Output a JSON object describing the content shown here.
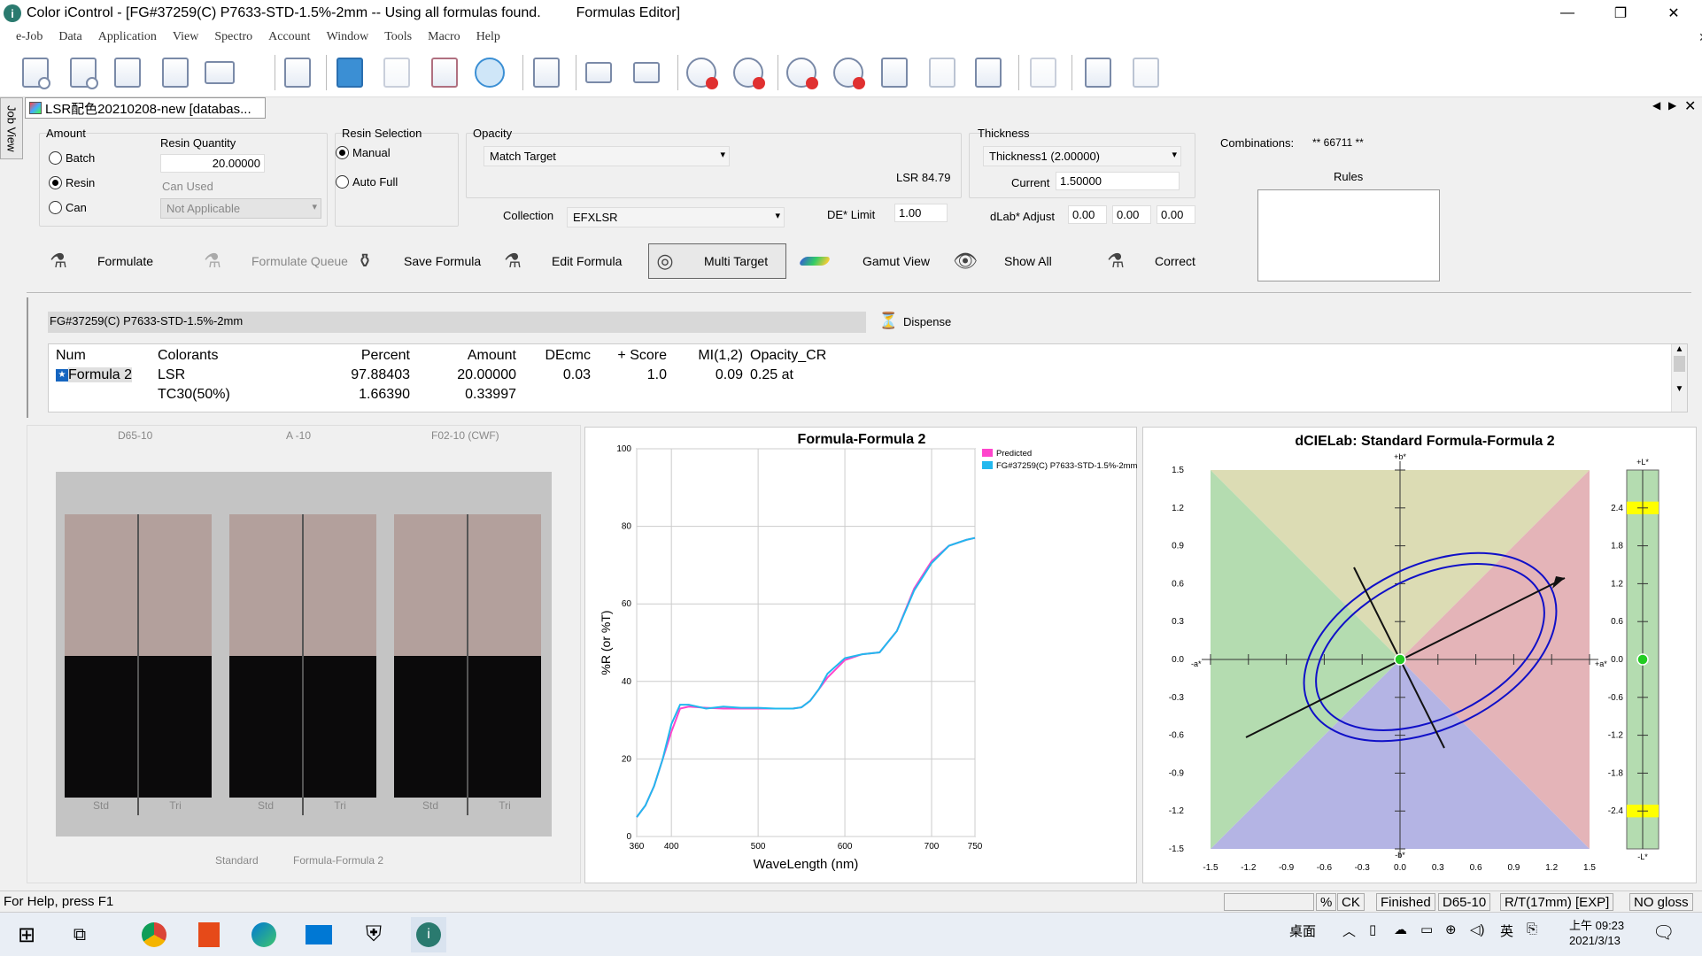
{
  "window": {
    "title": "Color iControl - [FG#37259(C) P7633-STD-1.5%-2mm -- Using all formulas found.",
    "editor_title": "Formulas Editor]",
    "minimize": "—",
    "restore": "❐",
    "close": "✕"
  },
  "menu": [
    "e-Job",
    "Data",
    "Application",
    "View",
    "Spectro",
    "Account",
    "Window",
    "Tools",
    "Macro",
    "Help"
  ],
  "menu_close": "✕",
  "jobview_label": "Job View",
  "doc_tab": "LSR配色20210208-new [databas...",
  "amount": {
    "group_label": "Amount",
    "batch": "Batch",
    "resin": "Resin",
    "can": "Can",
    "resin_qty_label": "Resin Quantity",
    "resin_qty_value": "20.00000",
    "can_used_label": "Can Used",
    "can_used_value": "Not Applicable"
  },
  "resin_selection": {
    "label": "Resin Selection",
    "manual": "Manual",
    "auto": "Auto  Full"
  },
  "opacity": {
    "label": "Opacity",
    "value": "Match Target",
    "lsr": "LSR 84.79"
  },
  "collection": {
    "label": "Collection",
    "value": "EFXLSR"
  },
  "de_limit": {
    "label": "DE* Limit",
    "value": "1.00"
  },
  "thickness": {
    "label": "Thickness",
    "value": "Thickness1 (2.00000)",
    "current_label": "Current",
    "current_value": "1.50000"
  },
  "dlab": {
    "label": "dLab* Adjust",
    "values": [
      "0.00",
      "0.00",
      "0.00"
    ]
  },
  "combinations": {
    "label": "Combinations:",
    "value": "** 66711 **"
  },
  "rules": {
    "label": "Rules"
  },
  "actions": {
    "formulate": "Formulate",
    "formulate_queue": "Formulate Queue",
    "save_formula": "Save Formula",
    "edit_formula": "Edit Formula",
    "multi_target": "Multi Target",
    "gamut_view": "Gamut View",
    "show_all": "Show All",
    "correct": "Correct"
  },
  "target_name": "FG#37259(C) P7633-STD-1.5%-2mm",
  "dispense": "Dispense",
  "formula_table": {
    "headers": [
      "Num",
      "Colorants",
      "Percent",
      "Amount",
      "DEcmc",
      "+ Score",
      "MI(1,2)",
      "Opacity_CR"
    ],
    "rows": [
      [
        "Formula 2",
        "LSR",
        "97.88403",
        "20.00000",
        "0.03",
        "1.0",
        "0.09",
        "0.25 at"
      ],
      [
        "",
        "TC30(50%)",
        "1.66390",
        "0.33997",
        "",
        "",
        "",
        ""
      ]
    ]
  },
  "swatches": {
    "illuminants": [
      "D65-10",
      "A  -10",
      "F02-10 (CWF)"
    ],
    "std": "Std",
    "tri": "Tri",
    "legend_standard": "Standard",
    "legend_formula": "Formula-Formula 2",
    "colors": {
      "top": "#b3a09c",
      "bottom": "#0b0a0b",
      "bg": "#c4c4c4"
    }
  },
  "chart_data": [
    {
      "type": "line",
      "title": "Formula-Formula 2",
      "xlabel": "WaveLength (nm)",
      "ylabel": "%R (or %T)",
      "xlim": [
        360,
        750
      ],
      "ylim": [
        0,
        100
      ],
      "xticks": [
        "360",
        "400",
        "500",
        "600",
        "700",
        "750"
      ],
      "yticks": [
        "0",
        "20",
        "40",
        "60",
        "80",
        "100"
      ],
      "x": [
        360,
        370,
        380,
        390,
        400,
        410,
        420,
        440,
        460,
        480,
        500,
        520,
        540,
        550,
        560,
        570,
        580,
        600,
        620,
        640,
        660,
        680,
        700,
        720,
        740,
        750
      ],
      "series": [
        {
          "name": "Predicted",
          "color": "#ff44cc",
          "values": [
            5,
            8,
            13,
            20,
            27,
            33,
            33.5,
            33.2,
            33,
            33,
            33,
            33,
            33,
            33.3,
            35,
            38,
            41,
            45.5,
            47,
            47.5,
            53,
            64,
            71,
            75,
            76.5,
            77
          ]
        },
        {
          "name": "FG#37259(C) P7633-STD-1.5%-2mm",
          "color": "#22b8ee",
          "values": [
            5,
            8,
            13,
            20,
            29,
            34,
            34,
            33,
            33.5,
            33.2,
            33.2,
            33,
            33,
            33.3,
            35,
            38,
            42,
            46,
            47,
            47.5,
            53,
            63.5,
            70.5,
            75,
            76.5,
            77
          ]
        }
      ]
    },
    {
      "type": "scatter",
      "title": "dCIELab: Standard  Formula-Formula 2",
      "xlim": [
        -1.5,
        1.5
      ],
      "ylim": [
        -1.5,
        1.5
      ],
      "xticks": [
        "-1.5",
        "-1.2",
        "-0.9",
        "-0.6",
        "-0.3",
        "0.0",
        "0.3",
        "0.6",
        "0.9",
        "1.2",
        "1.5"
      ],
      "yticks": [
        "1.5",
        "1.2",
        "0.9",
        "0.6",
        "0.3",
        "0.0",
        "-0.3",
        "-0.6",
        "-0.9",
        "-1.2",
        "-1.5"
      ],
      "axis_labels": {
        "plus_b": "+b*",
        "minus_b": "-b*",
        "plus_a": "+a*",
        "minus_a": "-a*",
        "plus_l": "+L*",
        "minus_l": "-L*"
      },
      "point": {
        "da": 0.0,
        "db": 0.0,
        "dL": 0.0
      },
      "l_ticks": [
        "2.4",
        "1.8",
        "1.2",
        "0.6",
        "0.0",
        "-0.6",
        "-1.2",
        "-1.8",
        "-2.4"
      ]
    }
  ],
  "status": {
    "help": "For Help, press F1",
    "boxes": [
      "%",
      "CK",
      "Finished",
      "D65-10",
      "R/T(17mm) [EXP]",
      "NO gloss"
    ]
  },
  "taskbar": {
    "desktop": "桌面",
    "ime": "英",
    "time": "上午 09:23",
    "date": "2021/3/13"
  }
}
